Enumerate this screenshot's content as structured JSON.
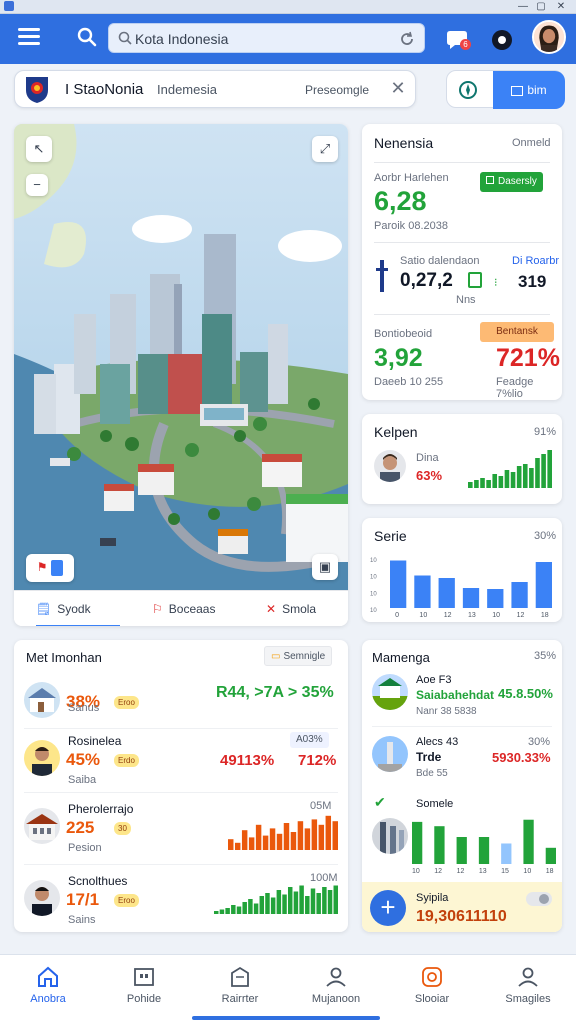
{
  "window": {
    "controls": [
      "—",
      "▢",
      "✕"
    ]
  },
  "header": {
    "search_placeholder": "Kota Indonesia",
    "notification_count": "6"
  },
  "location": {
    "title": "I StaoNonia",
    "subtitle": "Indemesia",
    "action": "Preseomgle",
    "right_button": "bim"
  },
  "map": {
    "tabs": [
      {
        "label": "Syodk",
        "icon": "book-icon"
      },
      {
        "label": "Boceaas",
        "icon": "flag-icon"
      },
      {
        "label": "Smola",
        "icon": "cross-icon"
      }
    ]
  },
  "stats": {
    "title": "Nenensia",
    "title_right": "Onmeld",
    "block1": {
      "label": "Aorbr Harlehen",
      "value": "6,28",
      "sub": "Paroik 08.2038",
      "pill": "Dasersly"
    },
    "block2": {
      "label": "Satio dalendaon",
      "value": "0,27,2",
      "label_right": "Di Roarbr",
      "value_right": "319",
      "mid": "Nns"
    },
    "block3": {
      "label": "Bontiobeoid",
      "pill": "Bentansk",
      "value": "3,92",
      "value_right": "721%",
      "sub": "Daeeb 10 255",
      "sub_right": "Feadge 7%lio"
    }
  },
  "kelpen": {
    "title": "Kelpen",
    "title_right": "91%",
    "name": "Dina",
    "pct": "63%"
  },
  "series_card": {
    "title": "Serie",
    "title_right": "30%",
    "y_ticks": [
      "10",
      "10",
      "10",
      "10"
    ],
    "x_ticks": [
      "0",
      "10",
      "12",
      "13",
      "10",
      "12",
      "18"
    ]
  },
  "list": {
    "title": "Met Imonhan",
    "action": "Semnigle",
    "rows": [
      {
        "name": "",
        "pct": "38%",
        "badge": "Eroo",
        "small": "Sanus",
        "value": "R44, >7A > 35%"
      },
      {
        "name": "Rosinelea",
        "pct": "45%",
        "badge": "Erdo",
        "small": "Saiba",
        "value_a": "49113%",
        "value_b": "712%",
        "chip": "A03%"
      },
      {
        "name": "Pherolerrajo",
        "pct": "225",
        "badge": "30",
        "small": "Pesion",
        "chart_label": "05M"
      },
      {
        "name": "Scnolthues",
        "pct": "17/1",
        "badge": "Eroo",
        "small": "Sains",
        "chart_label": "100M"
      }
    ]
  },
  "mamenga": {
    "title": "Mamenga",
    "title_right": "35%",
    "row1": {
      "name": "Aoe F3",
      "value": "Saiabahehdat",
      "pct": "45.8.50%",
      "small": "Nanr 38 5838"
    },
    "row2": {
      "name": "Alecs 43",
      "value": "Trde",
      "pct": "5930.33%",
      "pct_top": "30%",
      "small": "Bde 55"
    },
    "row3": {
      "name": "Somele"
    },
    "x_ticks": [
      "10",
      "12",
      "12",
      "13",
      "15",
      "10",
      "18"
    ],
    "footer": {
      "name": "Syipila",
      "value": "19,30611110"
    }
  },
  "nav": [
    {
      "label": "Anobra",
      "icon": "home-icon"
    },
    {
      "label": "Pohide",
      "icon": "tablet-icon"
    },
    {
      "label": "Rairrter",
      "icon": "building-icon"
    },
    {
      "label": "Mujanoon",
      "icon": "user-icon"
    },
    {
      "label": "Slooiar",
      "icon": "target-icon"
    },
    {
      "label": "Smagiles",
      "icon": "profile-icon"
    }
  ],
  "colors": {
    "primary": "#2f6fe0",
    "green": "#22a33a",
    "orange": "#ea580c",
    "red": "#dc2626",
    "blue": "#3b82f6"
  }
}
